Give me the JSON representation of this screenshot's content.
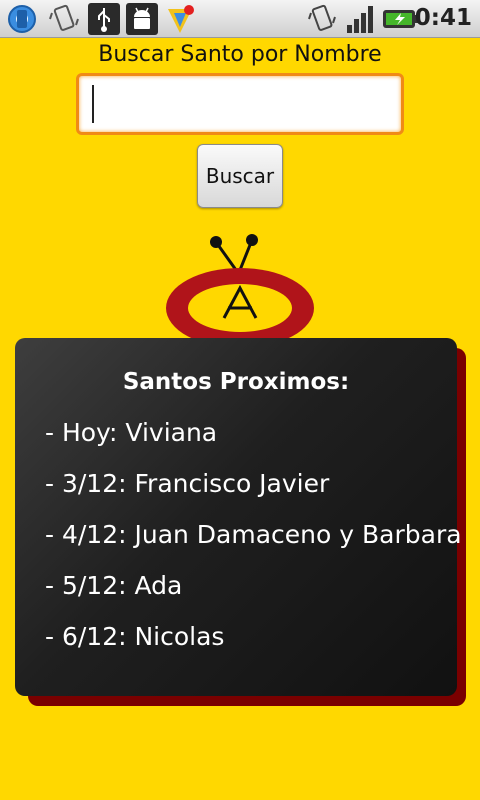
{
  "status_bar": {
    "time": "0:41",
    "icons": [
      "settings-gear-icon",
      "screen-rotate-icon",
      "usb-icon",
      "android-debug-icon",
      "app-notification-icon",
      "vibrate-icon",
      "signal-strength-icon",
      "battery-charging-icon"
    ]
  },
  "search": {
    "label": "Buscar Santo por Nombre",
    "input_value": "",
    "button_label": "Buscar"
  },
  "logo": {
    "icon": "antenna-logo-icon"
  },
  "upcoming": {
    "title": "Santos Proximos:",
    "items": [
      "- Hoy: Viviana",
      "- 3/12: Francisco Javier",
      "- 4/12: Juan Damaceno y Barbara",
      "- 5/12: Ada",
      "- 6/12: Nicolas"
    ]
  },
  "colors": {
    "background": "#ffd800",
    "input_border": "#f08a16",
    "card": "#1f1f1f",
    "card_shadow": "#7a0000",
    "logo_red": "#b0141a"
  }
}
